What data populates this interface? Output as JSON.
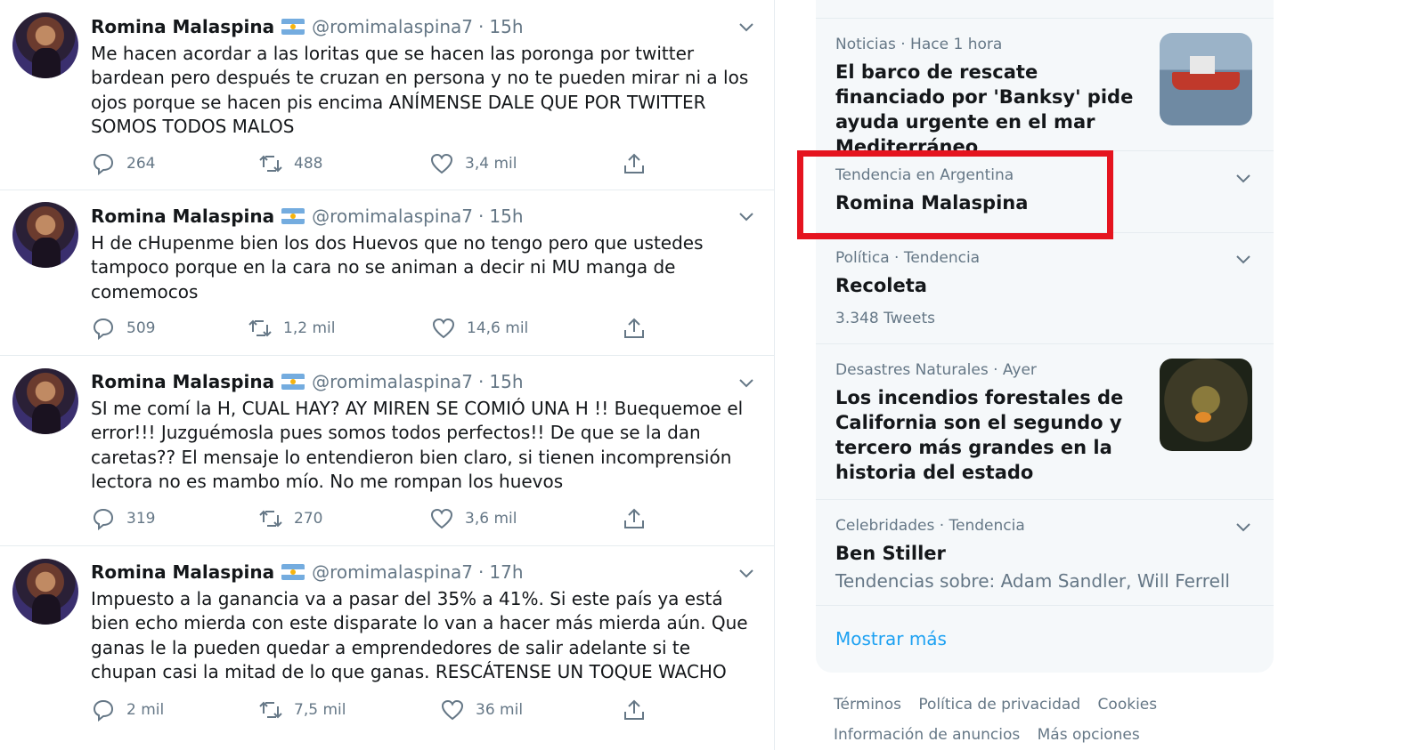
{
  "tweets": [
    {
      "name": "Romina Malaspina",
      "handle": "@romimalaspina7",
      "time": "15h",
      "text": "Me hacen acordar a las loritas que se hacen las poronga por twitter bardean pero después te cruzan en persona y no te pueden mirar ni a los ojos porque se hacen pis encima ANÍMENSE DALE QUE POR TWITTER SOMOS TODOS MALOS",
      "replies": "264",
      "retweets": "488",
      "likes": "3,4 mil"
    },
    {
      "name": "Romina Malaspina",
      "handle": "@romimalaspina7",
      "time": "15h",
      "text": "H de cHupenme bien los dos Huevos que no tengo pero que ustedes tampoco porque en la cara no se animan a decir ni MU manga de comemocos",
      "replies": "509",
      "retweets": "1,2 mil",
      "likes": "14,6 mil"
    },
    {
      "name": "Romina Malaspina",
      "handle": "@romimalaspina7",
      "time": "15h",
      "text": "SI me comí la H, CUAL HAY? AY MIREN SE COMIÓ UNA H !! Buequemoe el error!!! Juzguémosla pues somos todos perfectos!! De que se la dan caretas?? El mensaje lo entendieron bien claro, si tienen incomprensión lectora no es mambo mío. No me rompan los huevos",
      "replies": "319",
      "retweets": "270",
      "likes": "3,6 mil"
    },
    {
      "name": "Romina Malaspina",
      "handle": "@romimalaspina7",
      "time": "17h",
      "text": "Impuesto a la ganancia va a pasar del 35% a 41%. Si este país ya está bien echo mierda con este disparate lo van a hacer más mierda aún. Que ganas le la pueden quedar a emprendedores de salir adelante si te chupan casi la mitad de lo que ganas. RESCÁTENSE UN TOQUE WACHO",
      "replies": "2 mil",
      "retweets": "7,5 mil",
      "likes": "36 mil"
    }
  ],
  "trends": [
    {
      "meta": "Noticias · Hace 1 hora",
      "title": "El barco de rescate financiado por 'Banksy' pide ayuda urgente en el mar Mediterráneo"
    },
    {
      "meta": "Tendencia en Argentina",
      "title": "Romina Malaspina"
    },
    {
      "meta": "Política · Tendencia",
      "title": "Recoleta",
      "sub": "3.348 Tweets"
    },
    {
      "meta": "Desastres Naturales · Ayer",
      "title": "Los incendios forestales de California son el segundo y tercero más grandes en la historia del estado"
    },
    {
      "meta": "Celebridades · Tendencia",
      "title": "Ben Stiller",
      "sub": "Tendencias sobre: Adam Sandler, Will Ferrell"
    }
  ],
  "show_more": "Mostrar más",
  "footer": {
    "terms": "Términos",
    "privacy": "Política de privacidad",
    "cookies": "Cookies",
    "ads_info": "Información de anuncios",
    "more": "Más opciones"
  },
  "colors": {
    "accent": "#1da1f2",
    "highlight": "#e5141f",
    "muted": "#657786"
  }
}
